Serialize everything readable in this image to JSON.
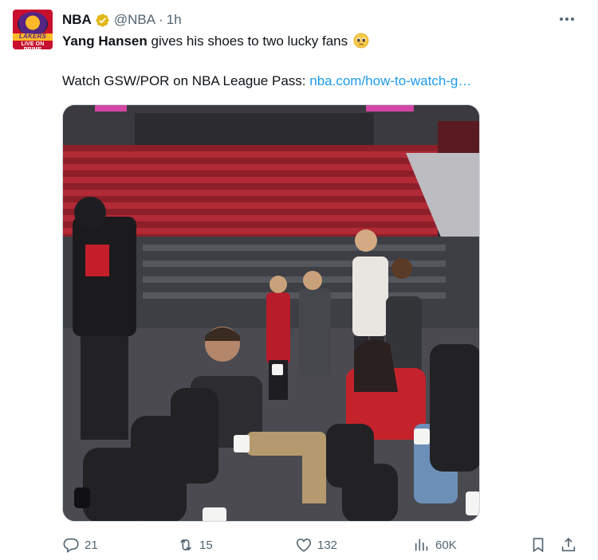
{
  "author": {
    "display_name": "NBA",
    "handle": "@NBA",
    "separator": "·",
    "time": "1h",
    "avatar_top_text": "LAKERS",
    "avatar_bottom_text": "LIVE ON PRIME"
  },
  "tweet": {
    "bold_name": "Yang Hansen",
    "text": "gives his shoes to two lucky fans",
    "emoji": "pleading-face-emoji",
    "line2_prefix": "Watch GSW/POR on NBA League Pass:",
    "link": "nba.com/how-to-watch-g…"
  },
  "actions": {
    "replies": "21",
    "reposts": "15",
    "likes": "132",
    "views": "60K"
  },
  "colors": {
    "link": "#1d9bf0",
    "secondary_text": "#536471",
    "verified_badge": "#e2b719"
  }
}
